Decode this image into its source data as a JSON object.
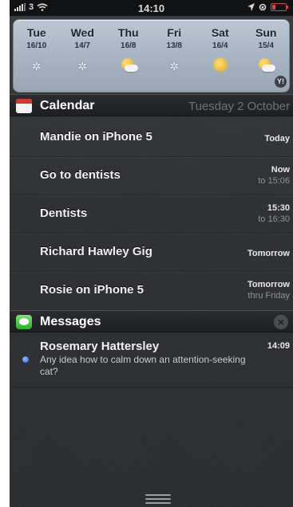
{
  "status_bar": {
    "carrier": "3",
    "time": "14:10",
    "icons": [
      "signal-icon",
      "wifi-icon",
      "location-icon",
      "rotation-lock-icon",
      "battery-icon"
    ],
    "battery_color": "#c84b4b"
  },
  "weather": {
    "days": [
      {
        "name": "Tue",
        "temp": "16/10",
        "icon": "snow-icon"
      },
      {
        "name": "Wed",
        "temp": "14/7",
        "icon": "snow-icon"
      },
      {
        "name": "Thu",
        "temp": "16/8",
        "icon": "sun-cloud-icon"
      },
      {
        "name": "Fri",
        "temp": "13/8",
        "icon": "snow-icon"
      },
      {
        "name": "Sat",
        "temp": "16/4",
        "icon": "sun-icon"
      },
      {
        "name": "Sun",
        "temp": "15/4",
        "icon": "sun-cloud-icon"
      }
    ],
    "provider_badge": "Y!"
  },
  "calendar": {
    "title": "Calendar",
    "date": "Tuesday 2 October",
    "events": [
      {
        "title": "Mandie on iPhone 5",
        "time": "Today",
        "sub": ""
      },
      {
        "title": "Go to dentists",
        "time": "Now",
        "sub": "to 15:06"
      },
      {
        "title": "Dentists",
        "time": "15:30",
        "sub": "to 16:30"
      },
      {
        "title": "Richard Hawley Gig",
        "time": "Tomorrow",
        "sub": ""
      },
      {
        "title": "Rosie on iPhone 5",
        "time": "Tomorrow",
        "sub": "thru Friday"
      }
    ]
  },
  "messages": {
    "title": "Messages",
    "close_label": "×",
    "items": [
      {
        "sender": "Rosemary Hattersley",
        "time": "14:09",
        "body": "Any idea how to calm down an attention-seeking cat?"
      }
    ]
  }
}
